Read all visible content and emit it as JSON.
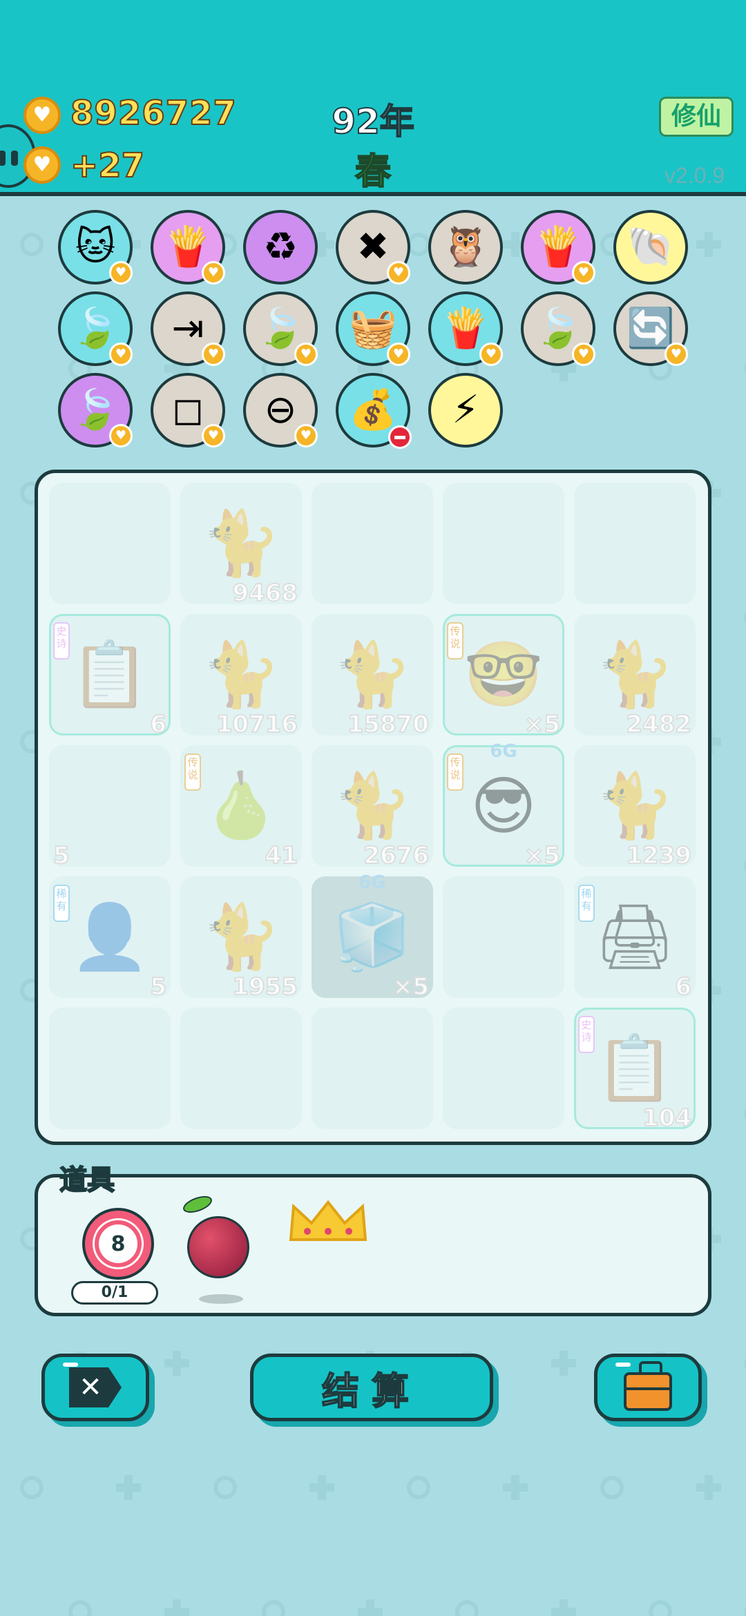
{
  "header": {
    "money": "8926727",
    "income": "+27",
    "year": "92年",
    "season": "春",
    "xiuxian_label": "修仙",
    "version": "v2.0.9"
  },
  "colors": {
    "header_bg": "#19c4c7",
    "page_bg": "#a9dde3",
    "coin": "#f6b526",
    "accent_teal": "#15c3c6",
    "outline": "#1d3b3e"
  },
  "relics": [
    {
      "name": "cat-with-coin-icon",
      "bg": "#79e0e7",
      "glyph": "🐱",
      "badge": "heart"
    },
    {
      "name": "fries-icon",
      "bg": "#e59ef0",
      "glyph": "🍟",
      "badge": "heart"
    },
    {
      "name": "recycle-icon",
      "bg": "#cd8ef0",
      "glyph": "♻",
      "badge": "none"
    },
    {
      "name": "remove-tag-icon",
      "bg": "#dcd6cc",
      "glyph": "✖",
      "badge": "heart"
    },
    {
      "name": "owls-icon",
      "bg": "#dcd6cc",
      "glyph": "🦉",
      "badge": "none"
    },
    {
      "name": "fries-icon-2",
      "bg": "#e59ef0",
      "glyph": "🍟",
      "badge": "heart"
    },
    {
      "name": "shell-icon",
      "bg": "#fff79a",
      "glyph": "🐚",
      "badge": "none"
    },
    {
      "name": "leaf-icon",
      "bg": "#79e0e7",
      "glyph": "🍃",
      "badge": "heart"
    },
    {
      "name": "skip-icon",
      "bg": "#dcd6cc",
      "glyph": "⇥",
      "badge": "heart"
    },
    {
      "name": "leaf-icon-2",
      "bg": "#dcd6cc",
      "glyph": "🍃",
      "badge": "heart"
    },
    {
      "name": "fruit-basket-icon",
      "bg": "#79e0e7",
      "glyph": "🧺",
      "badge": "heart"
    },
    {
      "name": "fries-icon-3",
      "bg": "#79e0e7",
      "glyph": "🍟",
      "badge": "heart"
    },
    {
      "name": "leaf-icon-3",
      "bg": "#dcd6cc",
      "glyph": "🍃",
      "badge": "heart"
    },
    {
      "name": "refresh-icon",
      "bg": "#dcd6cc",
      "glyph": "🔄",
      "badge": "heart"
    },
    {
      "name": "leaf-icon-4",
      "bg": "#cd8ef0",
      "glyph": "🍃",
      "badge": "heart"
    },
    {
      "name": "sugar-cubes-icon",
      "bg": "#dcd6cc",
      "glyph": "◻",
      "badge": "heart"
    },
    {
      "name": "minus-circle-icon",
      "bg": "#dcd6cc",
      "glyph": "⊖",
      "badge": "heart"
    },
    {
      "name": "sack-icon",
      "bg": "#79e0e7",
      "glyph": "💰",
      "badge": "minus"
    },
    {
      "name": "lightning-icon",
      "bg": "#fff79a",
      "glyph": "⚡",
      "badge": "none"
    }
  ],
  "board": [
    {
      "sym": "",
      "num": "",
      "tag": ""
    },
    {
      "sym": "🐈",
      "num": "9468",
      "tag": ""
    },
    {
      "sym": "",
      "num": "",
      "tag": ""
    },
    {
      "sym": "",
      "num": "",
      "tag": ""
    },
    {
      "sym": "",
      "num": "",
      "tag": ""
    },
    {
      "sym": "📋",
      "num": "6",
      "tag": "史诗",
      "tagtype": "epic",
      "glow": true,
      "name": "copy-paste-cell"
    },
    {
      "sym": "🐈",
      "num": "10716",
      "tag": ""
    },
    {
      "sym": "🐈",
      "num": "15870",
      "tag": ""
    },
    {
      "sym": "🤓",
      "num": "×5",
      "tag": "传说",
      "tagtype": "leg",
      "glow": true,
      "name": "nerd-king-cell"
    },
    {
      "sym": "🐈",
      "num": "2482",
      "tag": ""
    },
    {
      "sym": "",
      "num": "5",
      "numleft": true,
      "tag": ""
    },
    {
      "sym": "🍐",
      "num": "41",
      "tag": "传说",
      "tagtype": "leg",
      "name": "pear-cell"
    },
    {
      "sym": "🐈",
      "num": "2676",
      "tag": ""
    },
    {
      "sym": "😎",
      "num": "×5",
      "top": "6G",
      "tag": "传说",
      "tagtype": "leg",
      "glow": true,
      "name": "sunglasses-king-cell"
    },
    {
      "sym": "🐈",
      "num": "1239",
      "tag": ""
    },
    {
      "sym": "👤",
      "num": "5",
      "tag": "稀有",
      "tagtype": "rare",
      "name": "hat-man-cell"
    },
    {
      "sym": "🐈",
      "num": "1955",
      "tag": ""
    },
    {
      "sym": "🧊",
      "num": "×5",
      "top": "6G",
      "tag": "",
      "dim": true,
      "name": "fridge-cell"
    },
    {
      "sym": "",
      "num": "",
      "tag": ""
    },
    {
      "sym": "🖨",
      "num": "6",
      "tag": "稀有",
      "tagtype": "rare",
      "name": "printer-cell"
    },
    {
      "sym": "",
      "num": "",
      "tag": ""
    },
    {
      "sym": "",
      "num": "",
      "tag": ""
    },
    {
      "sym": "",
      "num": "",
      "tag": ""
    },
    {
      "sym": "",
      "num": "",
      "tag": ""
    },
    {
      "sym": "📋",
      "num": "104",
      "tag": "史诗",
      "tagtype": "epic",
      "glow": true,
      "name": "copy-paste-cell-2"
    }
  ],
  "items": {
    "title": "道具",
    "target_value": "8",
    "target_count": "0/1"
  },
  "buttons": {
    "settle_label": "结算"
  }
}
